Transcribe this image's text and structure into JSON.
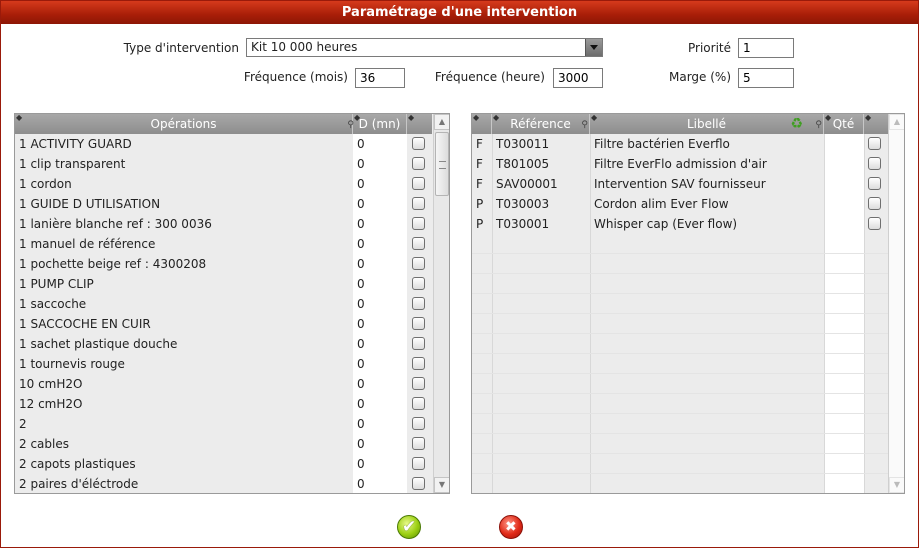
{
  "window": {
    "title": "Paramétrage d'une intervention"
  },
  "form": {
    "type_label": "Type d'intervention",
    "type_value": "Kit 10 000 heures",
    "priorite_label": "Priorité",
    "priorite_value": "1",
    "freq_mois_label": "Fréquence (mois)",
    "freq_mois_value": "36",
    "freq_heure_label": "Fréquence (heure)",
    "freq_heure_value": "3000",
    "marge_label": "Marge (%)",
    "marge_value": "5"
  },
  "operations": {
    "col_operations": "Opérations",
    "col_d": "D (mn)",
    "rows": [
      {
        "name": "1 ACTIVITY GUARD",
        "d": "0"
      },
      {
        "name": "1 clip transparent",
        "d": "0"
      },
      {
        "name": "1 cordon",
        "d": "0"
      },
      {
        "name": "1 GUIDE D UTILISATION",
        "d": "0"
      },
      {
        "name": "1 lanière blanche ref : 300 0036",
        "d": "0"
      },
      {
        "name": "1 manuel de référence",
        "d": "0"
      },
      {
        "name": "1 pochette beige ref : 4300208",
        "d": "0"
      },
      {
        "name": "1 PUMP CLIP",
        "d": "0"
      },
      {
        "name": "1 saccoche",
        "d": "0"
      },
      {
        "name": "1 SACCOCHE EN CUIR",
        "d": "0"
      },
      {
        "name": "1 sachet plastique douche",
        "d": "0"
      },
      {
        "name": "1 tournevis rouge",
        "d": "0"
      },
      {
        "name": "10 cmH2O",
        "d": "0"
      },
      {
        "name": "12 cmH2O",
        "d": "0"
      },
      {
        "name": "2",
        "d": "0"
      },
      {
        "name": "2 cables",
        "d": "0"
      },
      {
        "name": "2 capots plastiques",
        "d": "0"
      },
      {
        "name": "2 paires d'éléctrode",
        "d": "0"
      }
    ]
  },
  "articles": {
    "col_reference": "Référence",
    "col_libelle": "Libellé",
    "col_qte": "Qté",
    "rows": [
      {
        "type": "F",
        "ref": "T030011",
        "libelle": "Filtre bactérien Everflo"
      },
      {
        "type": "F",
        "ref": "T801005",
        "libelle": "Filtre EverFlo admission d'air"
      },
      {
        "type": "F",
        "ref": "SAV00001",
        "libelle": "Intervention SAV fournisseur"
      },
      {
        "type": "P",
        "ref": "T030003",
        "libelle": "Cordon alim Ever Flow"
      },
      {
        "type": "P",
        "ref": "T030001",
        "libelle": "Whisper cap (Ever flow)"
      }
    ]
  },
  "icons": {
    "ok": "check-icon",
    "cancel": "close-icon",
    "recycle": "recycle-icon",
    "search": "magnifier-icon",
    "pin": "pin-icon"
  }
}
